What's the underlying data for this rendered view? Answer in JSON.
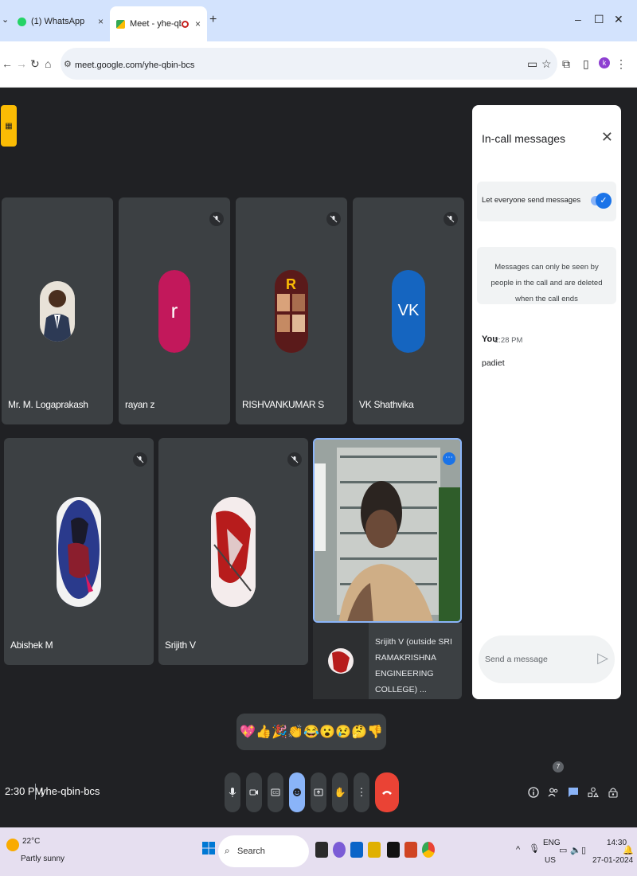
{
  "browser": {
    "tabs": [
      {
        "label": "(1) WhatsApp",
        "close": "×"
      },
      {
        "label": "Meet - yhe-qbin-bcs",
        "close": "×"
      }
    ],
    "tab_dropdown": "⌄",
    "new_tab": "+",
    "window_controls": {
      "minimize": "–",
      "maximize": "☐",
      "close": "✕"
    },
    "address": {
      "url": "meet.google.com/yhe-qbin-bcs"
    },
    "profile_initial": "k"
  },
  "meeting": {
    "participants": [
      {
        "name": "Mr. M. Logaprakash",
        "muted": false,
        "avatar_type": "photo"
      },
      {
        "name": "rayan z",
        "muted": true,
        "avatar_type": "initial",
        "initial": "r",
        "color": "#c2185b"
      },
      {
        "name": "RISHVANKUMAR S",
        "muted": true,
        "avatar_type": "photo"
      },
      {
        "name": "VK Shathvika",
        "muted": true,
        "avatar_type": "initial",
        "initial": "VK",
        "color": "#1565c0"
      },
      {
        "name": "Abishek M",
        "muted": true,
        "avatar_type": "photo"
      },
      {
        "name": "Srijith V",
        "muted": true,
        "avatar_type": "photo"
      }
    ],
    "pinned": {
      "name": "Srijith V (outside SRI RAMAKRISHNA ENGINEERING COLLEGE) ..."
    },
    "time": "2:30 PM",
    "code": "yhe-qbin-bcs",
    "people_count": "7"
  },
  "panel": {
    "title": "In-call messages",
    "permission_label": "Let everyone send messages",
    "permission_enabled": true,
    "info": "Messages can only be seen by people in the call and are deleted when the call ends",
    "messages": [
      {
        "sender": "You",
        "time": "2:28 PM",
        "text": "padiet"
      }
    ],
    "input_placeholder": "Send a message"
  },
  "reactions": [
    "💖",
    "👍",
    "🎉",
    "👏",
    "😂",
    "😮",
    "😢",
    "🤔",
    "👎"
  ],
  "taskbar": {
    "weather_temp": "22°C",
    "weather_desc": "Partly sunny",
    "search_label": "Search",
    "lang_line1": "ENG",
    "lang_line2": "US",
    "clock_time": "14:30",
    "clock_date": "27-01-2024"
  },
  "colors": {
    "accent": "#1a73e8",
    "end_call": "#ea4335",
    "tile_bg": "#3c4043",
    "meet_bg": "#202124"
  }
}
